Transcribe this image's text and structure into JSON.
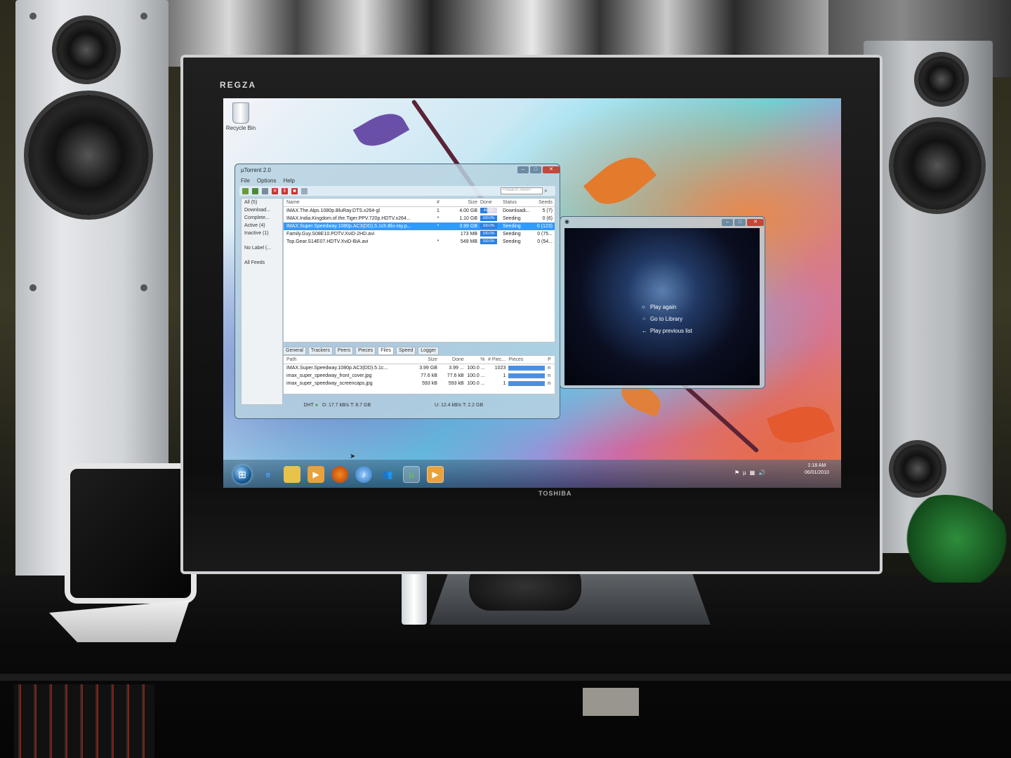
{
  "tv": {
    "brand_top": "REGZA",
    "brand_bottom": "TOSHIBA"
  },
  "desktop": {
    "recycle_bin_label": "Recycle Bin"
  },
  "utorrent": {
    "title": "µTorrent 2.0",
    "menu": [
      "File",
      "Options",
      "Help"
    ],
    "search_placeholder": "<Search Here>",
    "sidebar": [
      "All (5)",
      "Download...",
      "Complete...",
      "Active (4)",
      "Inactive (1)",
      "No Label (...",
      "All Feeds"
    ],
    "columns": {
      "name": "Name",
      "num": "#",
      "size": "Size",
      "done": "Done",
      "status": "Status",
      "seeds": "Seeds"
    },
    "torrents": [
      {
        "name": "IMAX.The.Alps.1080p.BluRay.DTS.x264-gl",
        "num": "1",
        "size": "4.00 GB",
        "done": "40.0%",
        "progress": 0.4,
        "status": "Downloadi...",
        "seeds": "5 (7)"
      },
      {
        "name": "IMAX.India.Kingdom.of.the.Tiger.PPV.720p.HDTV.x264...",
        "num": "*",
        "size": "1.10 GB",
        "done": "100.0%",
        "progress": 1.0,
        "status": "Seeding",
        "seeds": "0 (6)"
      },
      {
        "name": "IMAX.Super.Speedway.1080p.AC3(DD).5.1ch.Blu-ray.p...",
        "num": "*",
        "size": "3.99 GB",
        "done": "100.0%",
        "progress": 1.0,
        "status": "Seeding",
        "seeds": "0 (123)"
      },
      {
        "name": "Family.Guy.S08E10.PDTV.XviD-2HD.avi",
        "num": "",
        "size": "173 MB",
        "done": "100.0%",
        "progress": 1.0,
        "status": "Seeding",
        "seeds": "0 (75..."
      },
      {
        "name": "Top.Gear.S14E07.HDTV.XviD-BiA.avi",
        "num": "*",
        "size": "549 MB",
        "done": "100.0%",
        "progress": 1.0,
        "status": "Seeding",
        "seeds": "0 (54..."
      }
    ],
    "tabs": [
      "General",
      "Trackers",
      "Peers",
      "Pieces",
      "Files",
      "Speed",
      "Logger"
    ],
    "file_columns": {
      "path": "Path",
      "size": "Size",
      "done": "Done",
      "pct": "%",
      "pieces_count": "# Piec...",
      "pieces": "Pieces",
      "p": "P"
    },
    "files": [
      {
        "path": "IMAX.Super.Speedway.1080p.AC3(DD).5.1c...",
        "size": "3.99 GB",
        "done": "3.99 ...",
        "pct": "100.0 ...",
        "pieces_count": "1023",
        "p": "n"
      },
      {
        "path": "imax_super_speedway_front_cover.jpg",
        "size": "77.6 kB",
        "done": "77.6 kB",
        "pct": "100.0 ...",
        "pieces_count": "1",
        "p": "n"
      },
      {
        "path": "imax_super_speedway_screencaps.jpg",
        "size": "593 kB",
        "done": "593 kB",
        "pct": "100.0 ...",
        "pieces_count": "1",
        "p": "n"
      }
    ],
    "status_dht": "DHT",
    "status_down": "D: 17.7 kB/s T: 8.7 GB",
    "status_up": "U: 12.4 kB/s T: 2.2 GB"
  },
  "media_player": {
    "options": [
      "Play again",
      "Go to Library",
      "Play previous list"
    ]
  },
  "taskbar": {
    "clock_time": "1:18 AM",
    "clock_date": "06/01/2010"
  },
  "colors": {
    "selection": "#3399ff",
    "progress": "#2a7fe0",
    "close_button": "#c4473a"
  }
}
